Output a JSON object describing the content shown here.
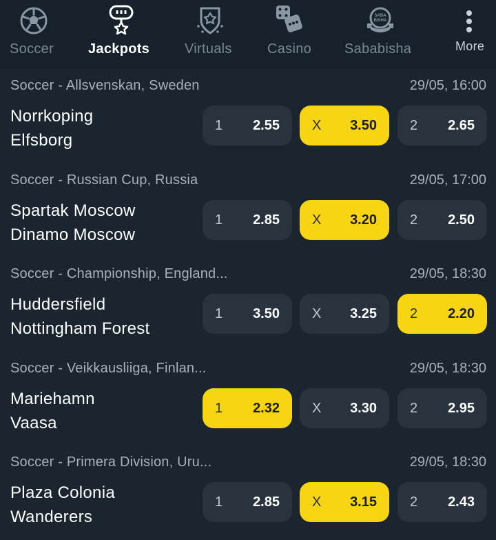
{
  "nav": {
    "items": [
      {
        "label": "Soccer",
        "icon": "soccer-ball-icon"
      },
      {
        "label": "Jackpots",
        "icon": "jackpot-icon",
        "active": true
      },
      {
        "label": "Virtuals",
        "icon": "virtuals-shield-icon"
      },
      {
        "label": "Casino",
        "icon": "dice-icon"
      },
      {
        "label": "Sababisha",
        "icon": "sababisha-badge-icon",
        "badge_text": "SABA BISHA"
      },
      {
        "label": "More",
        "icon": "kebab-menu-icon"
      }
    ]
  },
  "matches": [
    {
      "league": "Soccer - Allsvenskan, Sweden",
      "time": "29/05, 16:00",
      "home": "Norrkoping",
      "away": "Elfsborg",
      "odds": [
        {
          "label": "1",
          "value": "2.55"
        },
        {
          "label": "X",
          "value": "3.50"
        },
        {
          "label": "2",
          "value": "2.65"
        }
      ],
      "selected": "X"
    },
    {
      "league": "Soccer - Russian Cup, Russia",
      "time": "29/05, 17:00",
      "home": "Spartak Moscow",
      "away": "Dinamo Moscow",
      "odds": [
        {
          "label": "1",
          "value": "2.85"
        },
        {
          "label": "X",
          "value": "3.20"
        },
        {
          "label": "2",
          "value": "2.50"
        }
      ],
      "selected": "X"
    },
    {
      "league": "Soccer - Championship, England...",
      "time": "29/05, 18:30",
      "home": "Huddersfield",
      "away": "Nottingham Forest",
      "odds": [
        {
          "label": "1",
          "value": "3.50"
        },
        {
          "label": "X",
          "value": "3.25"
        },
        {
          "label": "2",
          "value": "2.20"
        }
      ],
      "selected": "2"
    },
    {
      "league": "Soccer - Veikkausliiga, Finlan...",
      "time": "29/05, 18:30",
      "home": "Mariehamn",
      "away": "Vaasa",
      "odds": [
        {
          "label": "1",
          "value": "2.32"
        },
        {
          "label": "X",
          "value": "3.30"
        },
        {
          "label": "2",
          "value": "2.95"
        }
      ],
      "selected": "1"
    },
    {
      "league": "Soccer - Primera Division, Uru...",
      "time": "29/05, 18:30",
      "home": "Plaza Colonia",
      "away": "Wanderers",
      "odds": [
        {
          "label": "1",
          "value": "2.85"
        },
        {
          "label": "X",
          "value": "3.15"
        },
        {
          "label": "2",
          "value": "2.43"
        }
      ],
      "selected": "X"
    }
  ],
  "colors": {
    "background": "#1b2530",
    "nav_background": "#17212b",
    "odd_button": "#28333e",
    "selected_odd": "#f8d512",
    "muted_text": "#a8b1ba"
  }
}
